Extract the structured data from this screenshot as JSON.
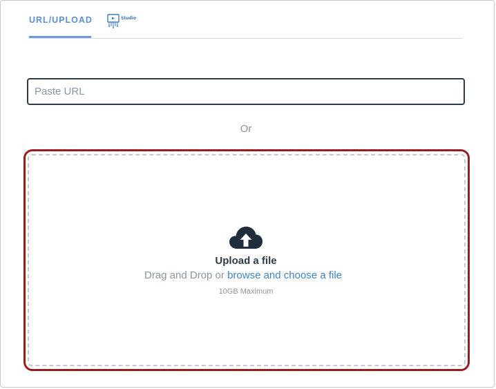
{
  "tabs": {
    "url_upload_label": "URL/UPLOAD",
    "studio_label": "Studio"
  },
  "url_input": {
    "placeholder": "Paste URL",
    "value": ""
  },
  "or_text": "Or",
  "upload": {
    "icon": "cloud-upload-icon",
    "title": "Upload a file",
    "drag_text": "Drag and Drop or",
    "browse_link": "browse and choose a file",
    "max_size": "10GB Maximum"
  },
  "colors": {
    "active_tab": "#5b8fd3",
    "link": "#3d83c7",
    "highlight_border": "#9b1c1c",
    "text_dark": "#2d3b45",
    "text_muted": "#8b969e"
  }
}
